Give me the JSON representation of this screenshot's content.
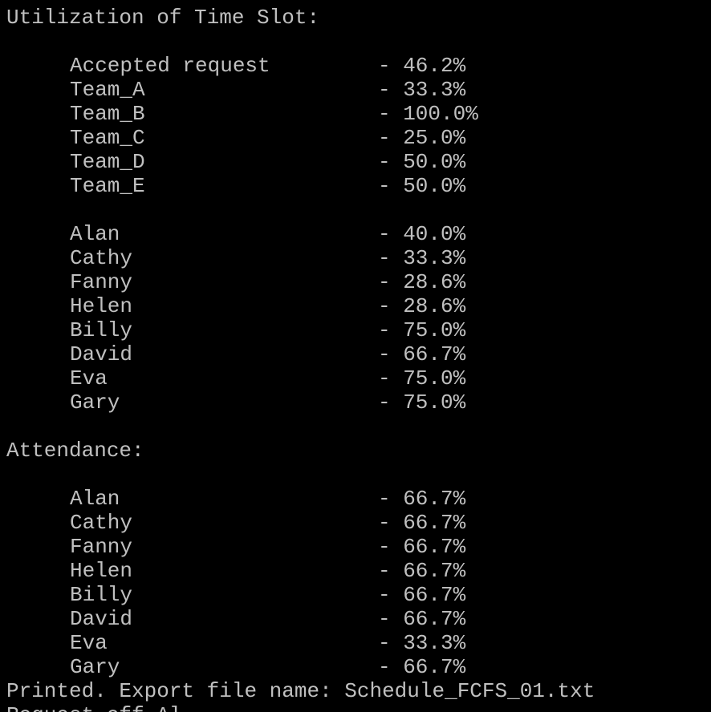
{
  "terminal": {
    "colors": {
      "background": "#000000",
      "text": "#c0c0c0"
    },
    "utilization_heading": "Utilization of Time Slot:",
    "utilization_groups": [
      {
        "label": "Accepted request",
        "value": "- 46.2%"
      },
      {
        "label": "Team_A",
        "value": "- 33.3%"
      },
      {
        "label": "Team_B",
        "value": "- 100.0%"
      },
      {
        "label": "Team_C",
        "value": "- 25.0%"
      },
      {
        "label": "Team_D",
        "value": "- 50.0%"
      },
      {
        "label": "Team_E",
        "value": "- 50.0%"
      }
    ],
    "utilization_members": [
      {
        "label": "Alan",
        "value": "- 40.0%"
      },
      {
        "label": "Cathy",
        "value": "- 33.3%"
      },
      {
        "label": "Fanny",
        "value": "- 28.6%"
      },
      {
        "label": "Helen",
        "value": "- 28.6%"
      },
      {
        "label": "Billy",
        "value": "- 75.0%"
      },
      {
        "label": "David",
        "value": "- 66.7%"
      },
      {
        "label": "Eva",
        "value": "- 75.0%"
      },
      {
        "label": "Gary",
        "value": "- 75.0%"
      }
    ],
    "attendance_heading": "Attendance:",
    "attendance_members": [
      {
        "label": "Alan",
        "value": "- 66.7%"
      },
      {
        "label": "Cathy",
        "value": "- 66.7%"
      },
      {
        "label": "Fanny",
        "value": "- 66.7%"
      },
      {
        "label": "Helen",
        "value": "- 66.7%"
      },
      {
        "label": "Billy",
        "value": "- 66.7%"
      },
      {
        "label": "David",
        "value": "- 66.7%"
      },
      {
        "label": "Eva",
        "value": "- 33.3%"
      },
      {
        "label": "Gary",
        "value": "- 66.7%"
      }
    ],
    "export_message": "Printed. Export file name: Schedule_FCFS_01.txt",
    "partial_next_line": "Request off Al"
  }
}
